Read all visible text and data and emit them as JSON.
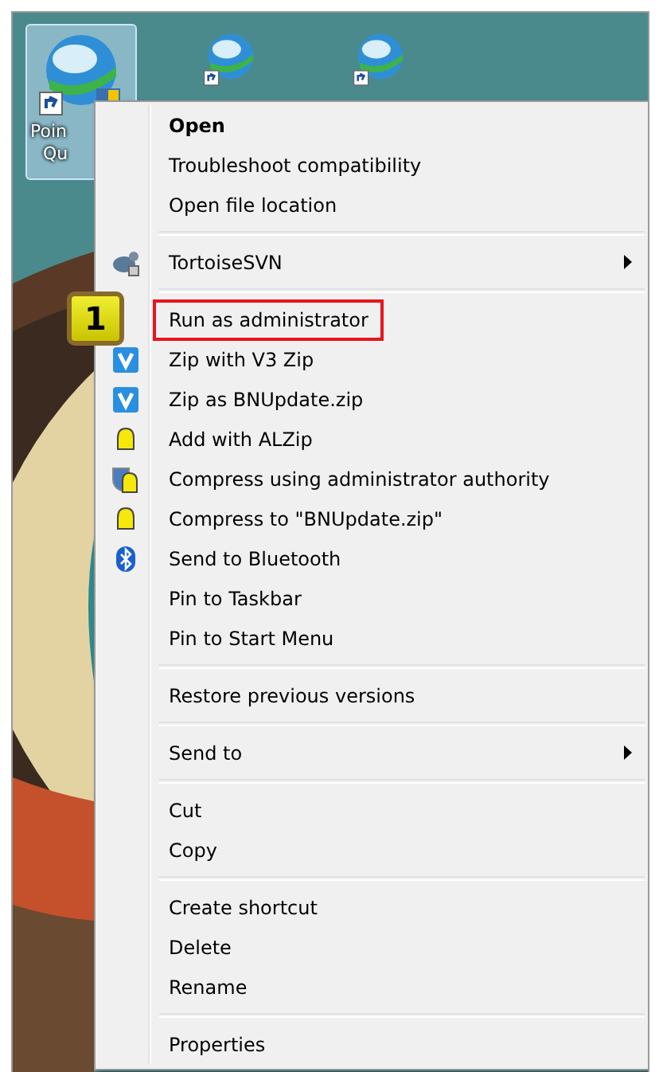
{
  "desktop_icons": [
    {
      "label_lines": [
        "Poin",
        "Qu"
      ],
      "selected": true,
      "shield": true
    },
    {
      "selected": false
    },
    {
      "selected": false
    }
  ],
  "context_menu": {
    "sections": [
      {
        "items": [
          {
            "label": "Open",
            "bold": true
          },
          {
            "label": "Troubleshoot compatibility"
          },
          {
            "label": "Open file location"
          }
        ]
      },
      {
        "items": [
          {
            "label": "TortoiseSVN",
            "kind": "tortoise",
            "submenu": true
          }
        ]
      },
      {
        "items": [
          {
            "label": "Run as administrator",
            "highlighted": true,
            "callout": "1"
          },
          {
            "label": "Zip with V3 Zip",
            "kind": "v3"
          },
          {
            "label": "Zip as BNUpdate.zip",
            "kind": "v3"
          },
          {
            "label": "Add with ALZip",
            "kind": "alzip"
          },
          {
            "label": "Compress using administrator authority",
            "kind": "alzip-shield"
          },
          {
            "label": "Compress to \"BNUpdate.zip\"",
            "kind": "alzip"
          },
          {
            "label": "Send to Bluetooth",
            "kind": "bluetooth"
          },
          {
            "label": "Pin to Taskbar"
          },
          {
            "label": "Pin to Start Menu"
          }
        ]
      },
      {
        "items": [
          {
            "label": "Restore previous versions"
          }
        ]
      },
      {
        "items": [
          {
            "label": "Send to",
            "submenu": true
          }
        ]
      },
      {
        "items": [
          {
            "label": "Cut"
          },
          {
            "label": "Copy"
          }
        ]
      },
      {
        "items": [
          {
            "label": "Create shortcut"
          },
          {
            "label": "Delete"
          },
          {
            "label": "Rename"
          }
        ]
      },
      {
        "items": [
          {
            "label": "Properties"
          }
        ]
      }
    ]
  }
}
